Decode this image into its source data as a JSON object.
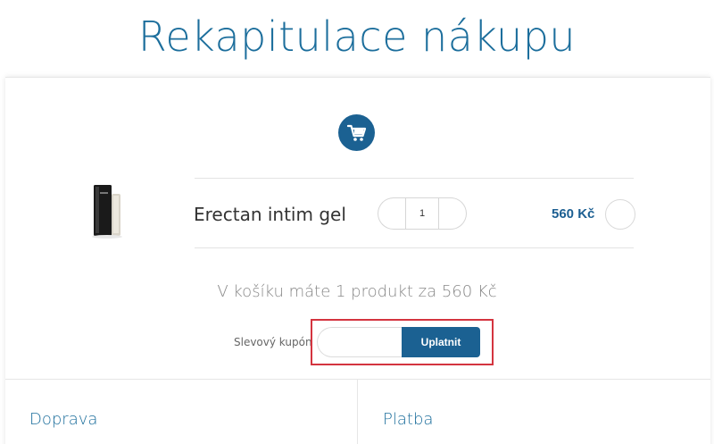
{
  "page": {
    "title": "Rekapitulace nákupu"
  },
  "icons": {
    "cart": "cart-icon",
    "product": "product-image"
  },
  "colors": {
    "accent": "#1b6192",
    "title": "#1c6e9c",
    "highlight": "#d4343f"
  },
  "cart": {
    "items": [
      {
        "name": "Erectan intim gel",
        "quantity": "1",
        "price": "560 Kč"
      }
    ],
    "summary": "V košíku máte 1 produkt za 560 Kč"
  },
  "coupon": {
    "label": "Slevový kupón",
    "value": "",
    "button_label": "Uplatnit"
  },
  "sections": {
    "shipping": "Doprava",
    "payment": "Platba"
  }
}
